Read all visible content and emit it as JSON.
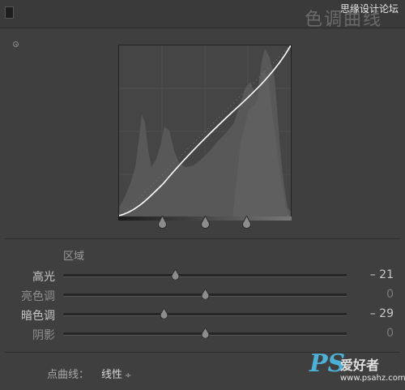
{
  "header": {
    "title": "色调曲线",
    "watermark": "思缘设计论坛"
  },
  "curve": {
    "region_label": "区域"
  },
  "sliders": [
    {
      "label": "高光",
      "value": "– 21",
      "level": -21,
      "active": true
    },
    {
      "label": "亮色调",
      "value": "0",
      "level": 0,
      "active": false
    },
    {
      "label": "暗色调",
      "value": "– 29",
      "level": -29,
      "active": true
    },
    {
      "label": "阴影",
      "value": "0",
      "level": 0,
      "active": false
    }
  ],
  "point_curve": {
    "label": "点曲线：",
    "value": "线性"
  },
  "watermark_bottom": {
    "brand": "PS",
    "name": "爱好者",
    "url": "www.psahz.com"
  },
  "colors": {
    "panel_bg": "#3f3f3f",
    "curve_line": "#ffffff",
    "accent": "#4db0d6"
  }
}
